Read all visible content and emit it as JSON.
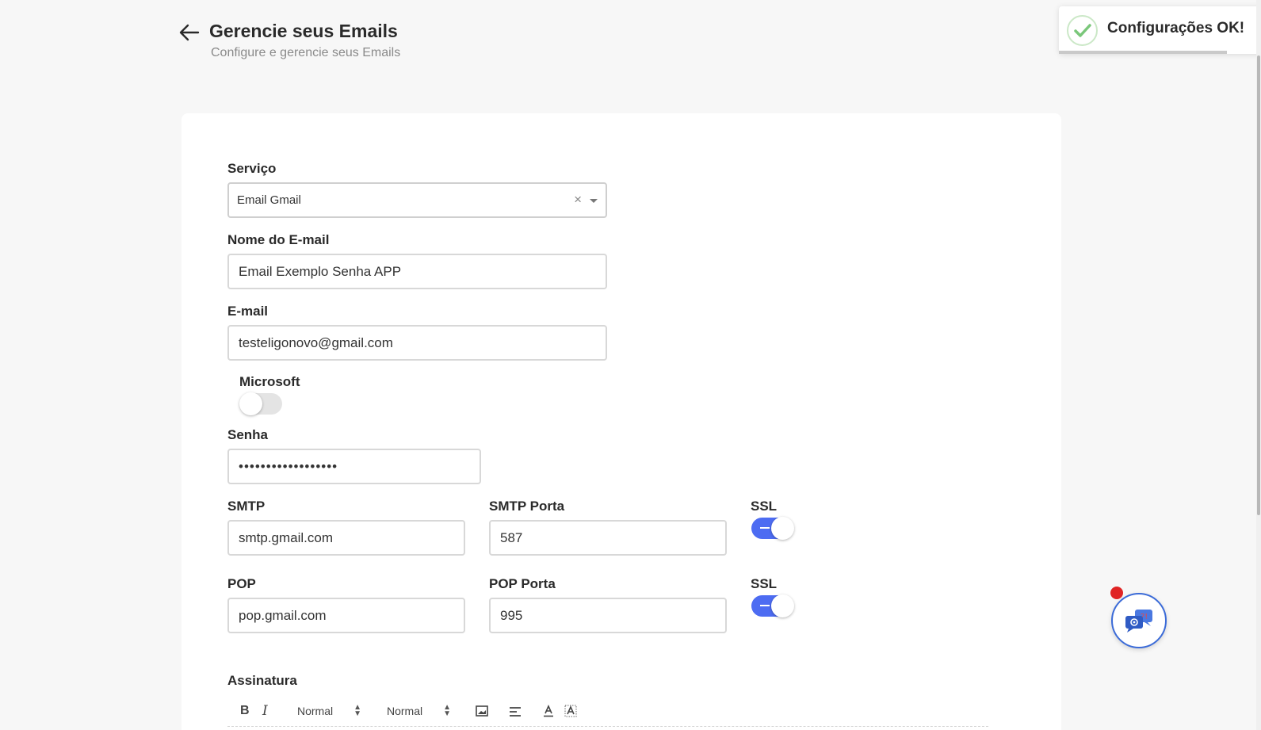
{
  "header": {
    "title": "Gerencie seus Emails",
    "subtitle": "Configure e gerencie seus Emails"
  },
  "toast": {
    "message": "Configurações OK!",
    "progress": 0.82,
    "icon": "check-icon",
    "accent": "#7ac77a"
  },
  "form": {
    "servico": {
      "label": "Serviço",
      "value": "Email Gmail"
    },
    "nome_email": {
      "label": "Nome do E-mail",
      "value": "Email Exemplo Senha APP"
    },
    "email": {
      "label": "E-mail",
      "value": "testeligonovo@gmail.com"
    },
    "microsoft": {
      "label": "Microsoft",
      "checked": false
    },
    "senha": {
      "label": "Senha",
      "value": "••••••••••••••••••"
    },
    "smtp": {
      "label": "SMTP",
      "value": "smtp.gmail.com"
    },
    "smtp_porta": {
      "label": "SMTP Porta",
      "value": "587"
    },
    "smtp_ssl": {
      "label": "SSL",
      "checked": true
    },
    "pop": {
      "label": "POP",
      "value": "pop.gmail.com"
    },
    "pop_porta": {
      "label": "POP Porta",
      "value": "995"
    },
    "pop_ssl": {
      "label": "SSL",
      "checked": true
    },
    "assinatura": {
      "label": "Assinatura"
    }
  },
  "editor_toolbar": {
    "bold": "B",
    "italic": "I",
    "font_size": "Normal",
    "heading": "Normal",
    "icons": [
      "image-icon",
      "align-icon",
      "text-color-icon",
      "background-color-icon"
    ]
  },
  "colors": {
    "accent": "#4d6cf2",
    "toggle_off": "#e4e4e4",
    "notification": "#e02424"
  }
}
